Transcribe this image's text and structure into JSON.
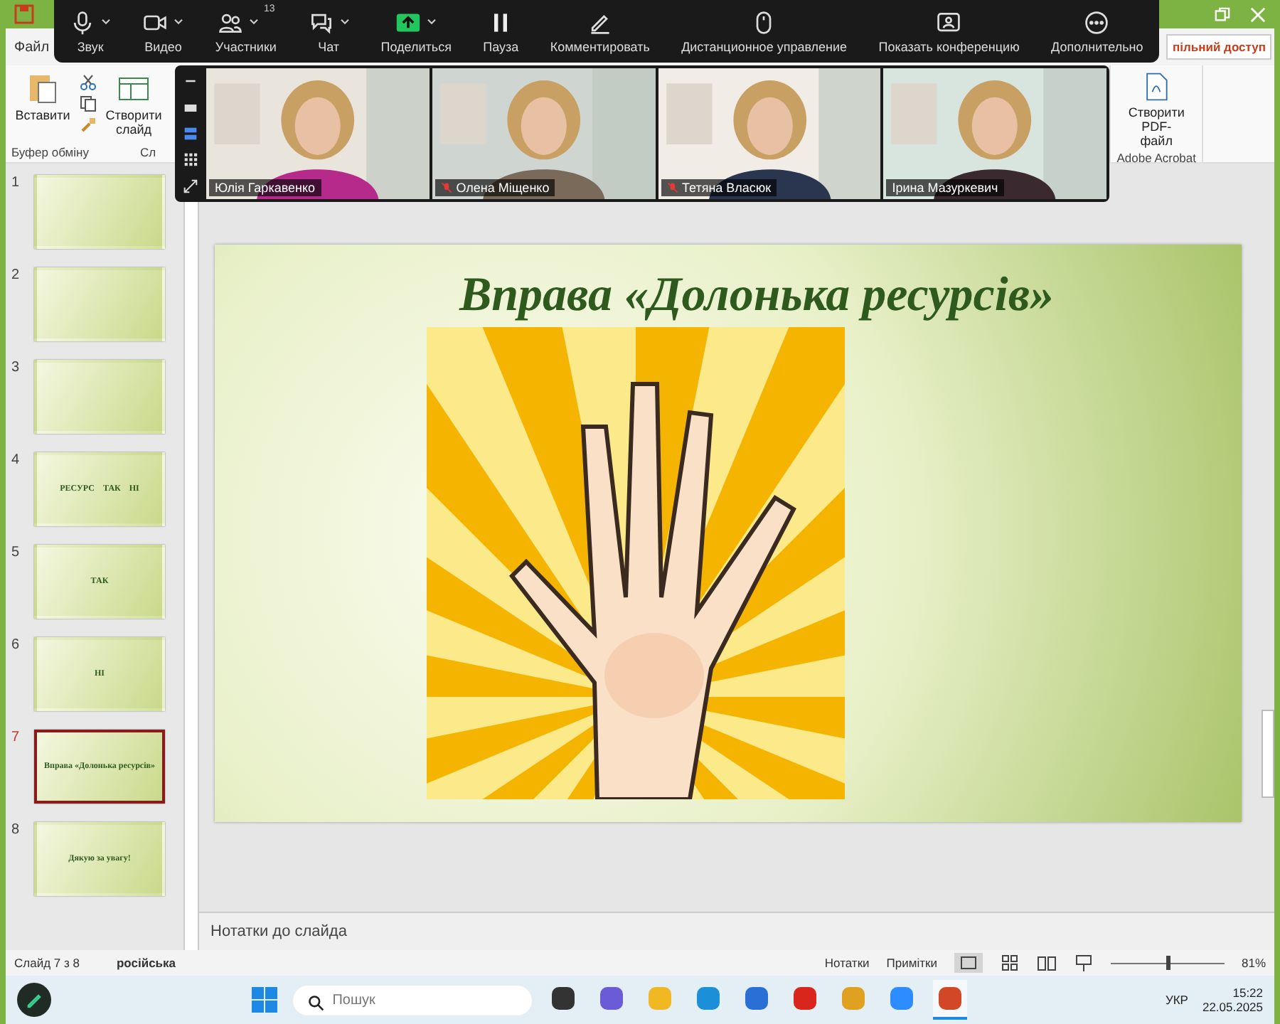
{
  "window": {
    "file_tab": "Файл",
    "share_button": "пільний доступ"
  },
  "ribbon": {
    "paste": "Вставити",
    "new_slide": "Створити слайд",
    "clipboard_group": "Буфер обміну",
    "slides_group": "Сл",
    "pdf_button": "Створити PDF-файл",
    "acrobat_group": "Adobe Acrobat"
  },
  "meeting_toolbar": [
    {
      "kind": "mic",
      "label": "Звук",
      "menu": true
    },
    {
      "kind": "camera",
      "label": "Видео",
      "menu": true
    },
    {
      "kind": "people",
      "label": "Участники",
      "menu": true,
      "badge": "13"
    },
    {
      "kind": "chat",
      "label": "Чат",
      "menu": true
    },
    {
      "kind": "share",
      "label": "Поделиться",
      "menu": true
    },
    {
      "kind": "pause",
      "label": "Пауза",
      "menu": false
    },
    {
      "kind": "pen",
      "label": "Комментировать",
      "menu": false
    },
    {
      "kind": "mouse",
      "label": "Дистанционное управление",
      "menu": false
    },
    {
      "kind": "screen",
      "label": "Показать конференцию",
      "menu": false
    },
    {
      "kind": "more",
      "label": "Дополнительно",
      "menu": false
    }
  ],
  "video_tiles": [
    {
      "name": "Юлія Гаркавенко",
      "muted": false
    },
    {
      "name": "Олена Міщенко",
      "muted": true
    },
    {
      "name": "Тетяна Власюк",
      "muted": true
    },
    {
      "name": "Ірина Мазуркевич",
      "muted": false
    }
  ],
  "thumbnails": [
    {
      "number": "1",
      "selected": false
    },
    {
      "number": "2",
      "selected": false
    },
    {
      "number": "3",
      "selected": false
    },
    {
      "number": "4",
      "selected": false,
      "texts": [
        "РЕСУРС",
        "ТАК",
        "НІ"
      ]
    },
    {
      "number": "5",
      "selected": false,
      "texts": [
        "ТАК"
      ]
    },
    {
      "number": "6",
      "selected": false,
      "texts": [
        "НІ"
      ]
    },
    {
      "number": "7",
      "selected": true,
      "texts": [
        "Вправа «Долонька ресурсів»"
      ]
    },
    {
      "number": "8",
      "selected": false,
      "texts": [
        "Дякую за увагу!"
      ]
    }
  ],
  "slide": {
    "title": "Вправа «Долонька ресурсів»"
  },
  "notes": {
    "placeholder": "Нотатки до слайда"
  },
  "status_bar": {
    "slide_count": "Слайд 7 з 8",
    "language": "російська",
    "notes_button": "Нотатки",
    "comments_button": "Примітки",
    "zoom": {
      "level": 0.5,
      "reading": "81%"
    }
  },
  "taskbar": {
    "search": {
      "placeholder": "Пошук"
    },
    "apps": [
      {
        "kind": "files",
        "active": false
      },
      {
        "kind": "meet",
        "active": false
      },
      {
        "kind": "folder",
        "active": false
      },
      {
        "kind": "browser",
        "active": false
      },
      {
        "kind": "store",
        "active": false
      },
      {
        "kind": "red",
        "active": false
      },
      {
        "kind": "chrome",
        "active": false
      },
      {
        "kind": "zoom",
        "active": false
      },
      {
        "kind": "slides",
        "active": true
      }
    ],
    "language": "УКР",
    "time": "15:22",
    "date": "22.05.2025"
  }
}
